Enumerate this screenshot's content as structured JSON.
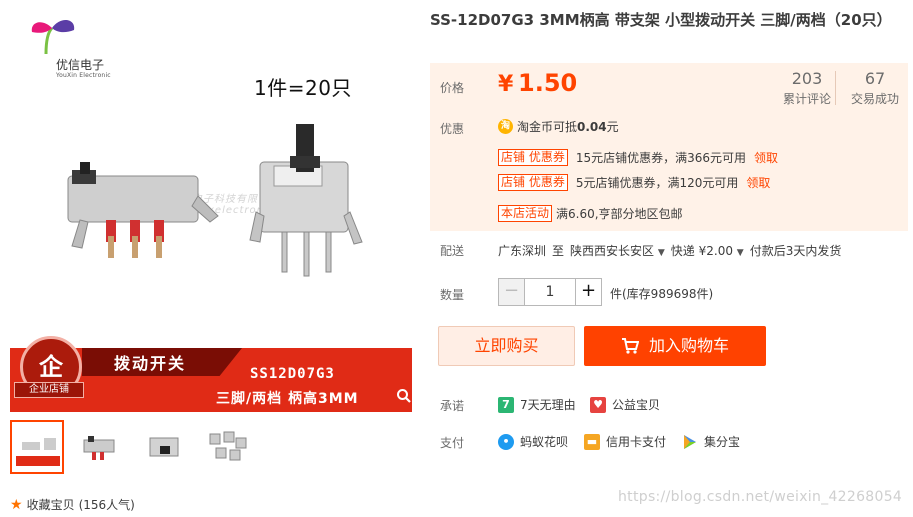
{
  "logo": {
    "name": "优信电子",
    "sub": "YouXin Electronic"
  },
  "main_image": {
    "qty_note": "1件=20只",
    "watermark": "优信电子科技有限公司 www.yxelectronic.taobao.com"
  },
  "banner": {
    "badge_glyph": "企",
    "badge_label": "企业店铺",
    "category": "拨动开关",
    "model": "SS12D07G3",
    "desc": "三脚/两档 柄高3MM"
  },
  "collect": {
    "label": "收藏宝贝",
    "count": "(156人气)"
  },
  "product": {
    "title": "SS-12D07G3 3MM柄高 带支架 小型拨动开关 三脚/两档（20只）",
    "price_label": "价格",
    "price_symbol": "¥",
    "price": "1.50",
    "reviews_count": "203",
    "reviews_label": "累计评论",
    "sales_count": "67",
    "sales_label": "交易成功"
  },
  "promotions": {
    "label": "优惠",
    "coin_icon": "淘",
    "coin_text": "淘金币可抵",
    "coin_amount": "0.04",
    "coin_unit": "元",
    "coupons": [
      {
        "tag": "店铺 优惠券",
        "text": "15元店铺优惠券，满366元可用",
        "link": "领取"
      },
      {
        "tag": "店铺 优惠券",
        "text": "5元店铺优惠券，满120元可用",
        "link": "领取"
      }
    ],
    "activity_tag": "本店活动",
    "activity_text": "满6.60,亨部分地区包邮"
  },
  "delivery": {
    "label": "配送",
    "from": "广东深圳",
    "to_word": "至",
    "to": "陕西西安长安区",
    "express": "快递 ¥2.00",
    "ship_note": "付款后3天内发货"
  },
  "quantity": {
    "label": "数量",
    "minus": "−",
    "value": "1",
    "plus": "+",
    "stock": "件(库存989698件)"
  },
  "actions": {
    "buy_now": "立即购买",
    "add_cart": "加入购物车"
  },
  "promise": {
    "label": "承诺",
    "items": [
      {
        "icon": "7",
        "text": "7天无理由"
      },
      {
        "icon": "♥",
        "text": "公益宝贝"
      }
    ]
  },
  "payment": {
    "label": "支付",
    "items": [
      {
        "text": "蚂蚁花呗"
      },
      {
        "text": "信用卡支付"
      },
      {
        "text": "集分宝"
      }
    ]
  },
  "watermark": "https://blog.csdn.net/weixin_42268054",
  "colors": {
    "accent": "#ff4400",
    "promo_bg": "#fff2e8",
    "banner_red": "#e02b16"
  }
}
